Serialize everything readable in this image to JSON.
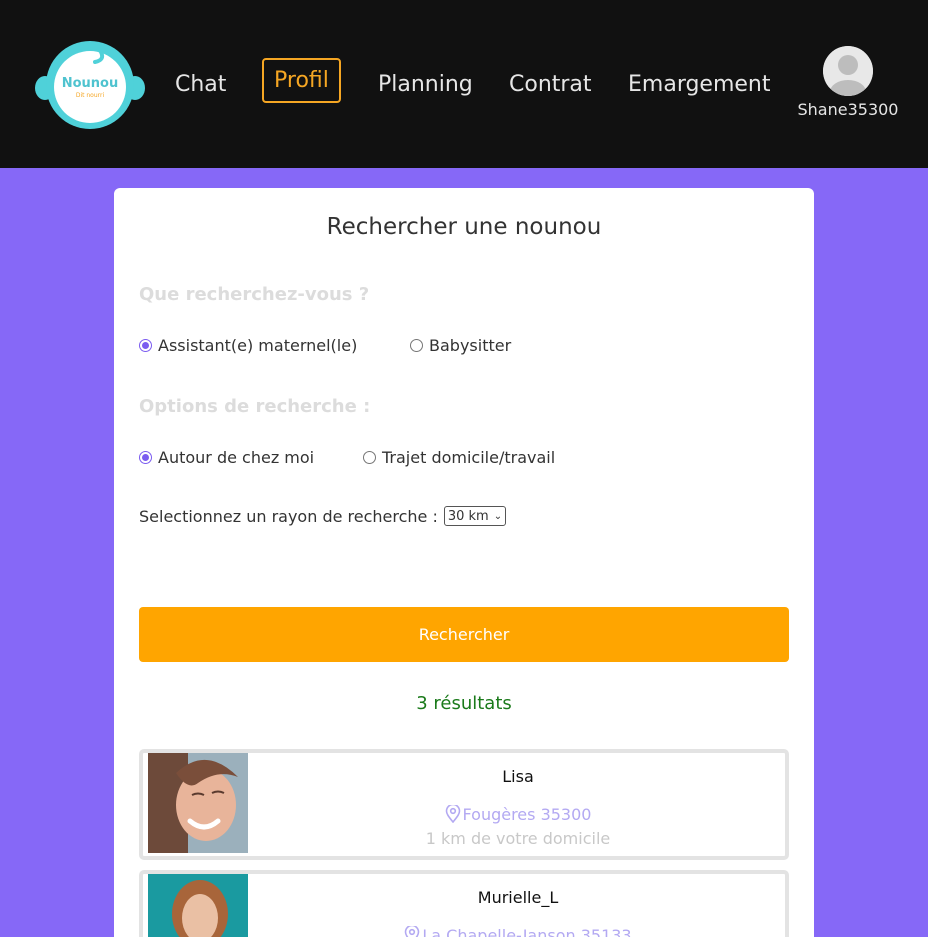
{
  "nav": {
    "logo_text": "Nounou",
    "logo_tagline": "Dit nourri",
    "items": [
      {
        "label": "Chat"
      },
      {
        "label": "Profil"
      },
      {
        "label": "Planning"
      },
      {
        "label": "Contrat"
      },
      {
        "label": "Emargement"
      }
    ],
    "active": "Profil",
    "username": "Shane35300"
  },
  "search": {
    "title": "Rechercher une nounou",
    "question1": "Que recherchez-vous ?",
    "type_options": [
      {
        "label": "Assistant(e) maternel(le)",
        "checked": true
      },
      {
        "label": "Babysitter",
        "checked": false
      }
    ],
    "question2": "Options de recherche :",
    "mode_options": [
      {
        "label": "Autour de chez moi",
        "checked": true
      },
      {
        "label": "Trajet domicile/travail",
        "checked": false
      }
    ],
    "radius_label": "Selectionnez un rayon de recherche :",
    "radius_value": "30 km",
    "button_label": "Rechercher",
    "results_count": "3 résultats"
  },
  "results": [
    {
      "name": "Lisa",
      "location": "Fougères 35300",
      "distance": "1 km de votre domicile"
    },
    {
      "name": "Murielle_L",
      "location": "La Chapelle-Janson 35133",
      "distance": ""
    }
  ],
  "colors": {
    "accent": "#ffa500",
    "brand": "#8668f7",
    "nav_bg": "#111111",
    "success": "#1a7a1a"
  }
}
